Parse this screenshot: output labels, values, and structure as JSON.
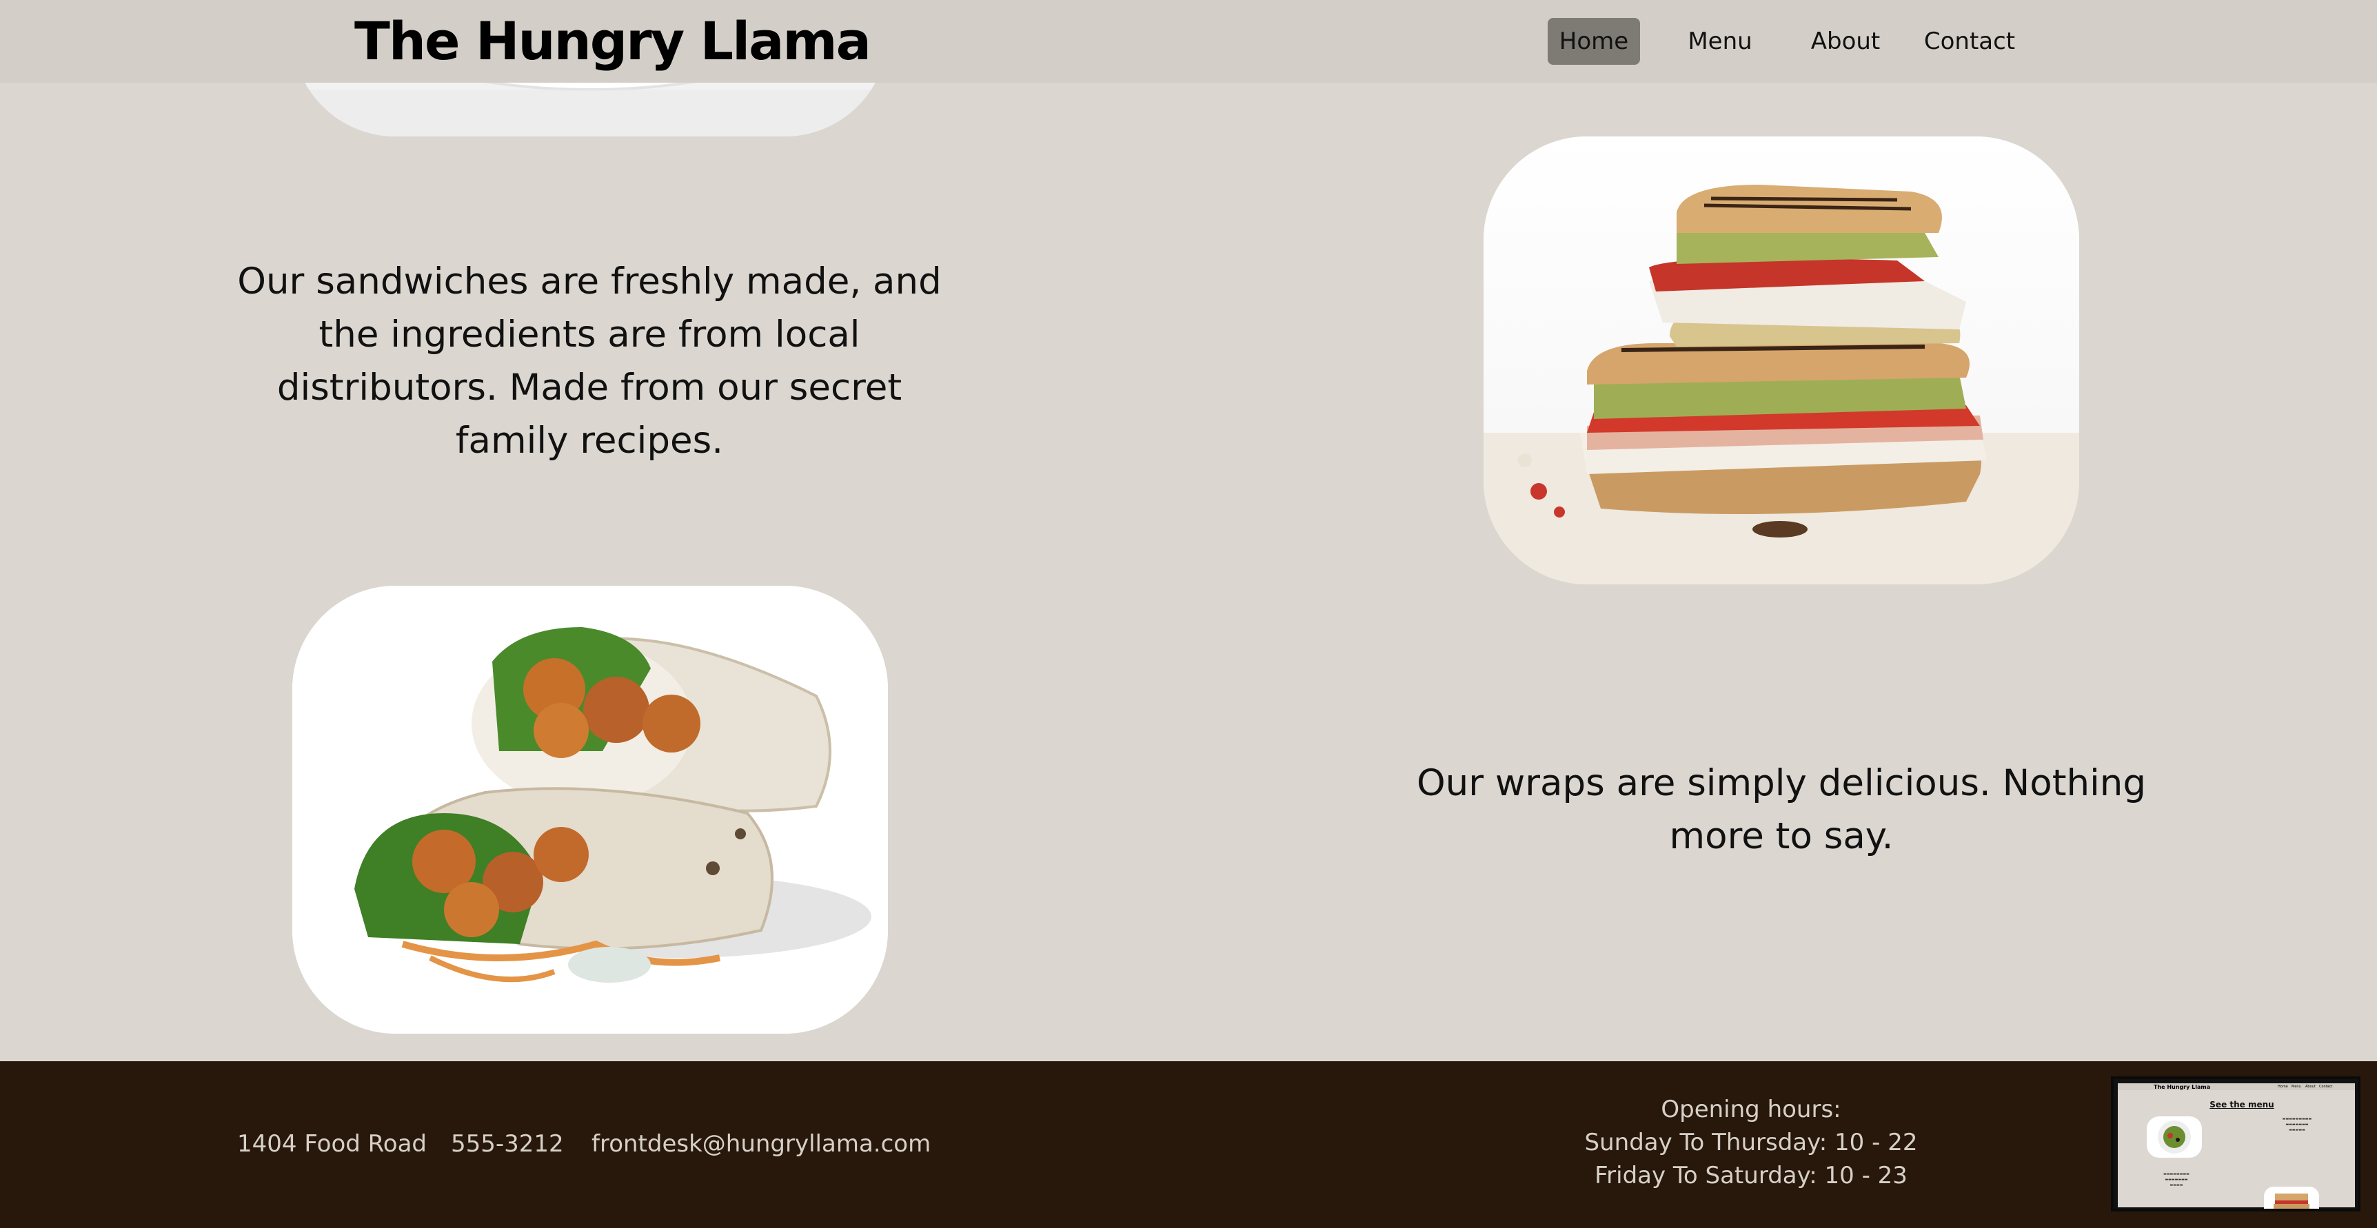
{
  "header": {
    "brand": "The Hungry Llama",
    "nav": [
      {
        "label": "Home",
        "active": true
      },
      {
        "label": "Menu",
        "active": false
      },
      {
        "label": "About",
        "active": false
      },
      {
        "label": "Contact",
        "active": false
      }
    ]
  },
  "sections": {
    "sandwich_text": "Our sandwiches are freshly made, and the ingredients are from local distributors. Made from our secret family recipes.",
    "wrap_text": "Our wraps are simply delicious. Nothing more to say."
  },
  "footer": {
    "address": "1404 Food Road",
    "phone": "555-3212",
    "email": "frontdesk@hungryllama.com",
    "hours_title": "Opening hours:",
    "hours_weekday": "Sunday To Thursday: 10 - 22",
    "hours_weekend": "Friday To Saturday: 10 - 23"
  },
  "preview": {
    "brand": "The Hungry Llama",
    "see_menu": "See the menu"
  },
  "colors": {
    "page_background": "#dbd7d0",
    "header_background": "#d3cfc8",
    "active_nav": "#7e7a74",
    "footer_background": "#28180b",
    "footer_text": "#d6d0c7"
  }
}
